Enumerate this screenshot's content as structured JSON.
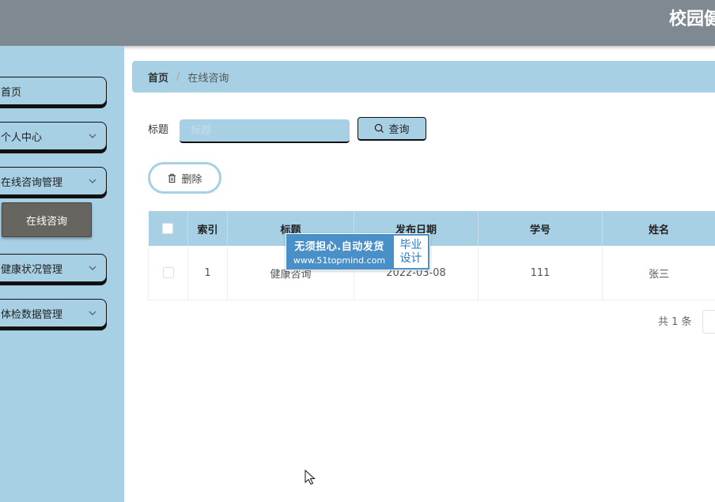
{
  "header": {
    "title": "校园健"
  },
  "sidebar": {
    "items": [
      {
        "label": "首页"
      },
      {
        "label": "个人中心"
      },
      {
        "label": "在线咨询管理"
      },
      {
        "label": "健康状况管理"
      },
      {
        "label": "体检数据管理"
      }
    ],
    "submenu": {
      "label": "在线咨询"
    }
  },
  "breadcrumb": {
    "home": "首页",
    "separator": "/",
    "current": "在线咨询"
  },
  "search": {
    "label": "标题",
    "placeholder": "标题",
    "button_label": "查询"
  },
  "actions": {
    "delete_label": "删除"
  },
  "table": {
    "columns": [
      "索引",
      "标题",
      "发布日期",
      "学号",
      "姓名"
    ],
    "rows": [
      {
        "index": "1",
        "title": "健康咨询",
        "date": "2022-03-08",
        "student_id": "111",
        "name": "张三"
      }
    ]
  },
  "pagination": {
    "total_text": "共 1 条"
  },
  "watermark": {
    "line1": "无须担心.自动发货",
    "line2": "www.51topmind.com",
    "badge_line1": "毕业",
    "badge_line2": "设计"
  },
  "icons": {
    "search": "search-icon",
    "delete": "trash-icon",
    "expand": "chevron-down-icon",
    "pointer": "mouse-cursor-icon"
  },
  "colors": {
    "accent": "#a7d0e4",
    "header_bg": "#7f8991",
    "submenu_bg": "#666560",
    "watermark_blue": "#4a90c8"
  }
}
